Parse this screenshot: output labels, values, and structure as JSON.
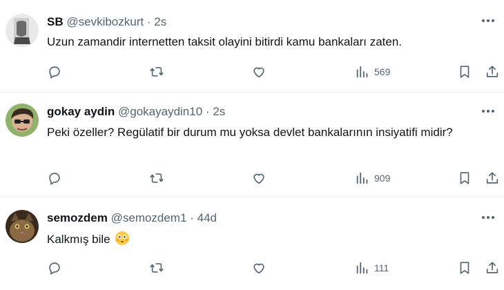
{
  "tweets": [
    {
      "name": "SB",
      "handle": "@sevkibozkurt",
      "time": "2s",
      "text": "Uzun zamandir internetten taksit olayini bitirdi kamu bankaları zaten.",
      "views": "569"
    },
    {
      "name": "gokay aydin",
      "handle": "@gokayaydin10",
      "time": "2s",
      "text": "Peki özeller? Regülatif bir durum mu yoksa devlet bankalarının insiyatifi midir?",
      "views": "909"
    },
    {
      "name": "semozdem",
      "handle": "@semozdem1",
      "time": "44d",
      "text": "Kalkmış bile",
      "emoji": "flushed-face",
      "views": "111"
    }
  ],
  "separator": "·",
  "icons": [
    "reply-icon",
    "retweet-icon",
    "like-icon",
    "views-icon",
    "bookmark-icon",
    "share-icon",
    "more-icon"
  ],
  "colors": {
    "text": "#0f1419",
    "secondary": "#536471",
    "divider": "#eff3f4"
  }
}
